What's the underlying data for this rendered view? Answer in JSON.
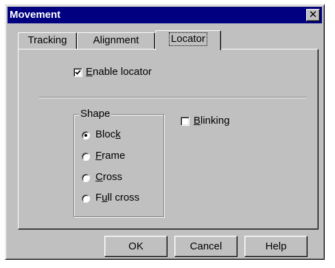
{
  "window": {
    "title": "Movement",
    "close_glyph": "✕"
  },
  "tabs": [
    {
      "label": "Tracking",
      "active": false
    },
    {
      "label": "Alignment",
      "active": false
    },
    {
      "label": "Locator",
      "active": true
    }
  ],
  "enable_locator": {
    "mnemonic": "E",
    "rest": "nable locator",
    "checked": true
  },
  "shape_group": {
    "title": "Shape",
    "options": [
      {
        "pre": "Bloc",
        "mnemonic": "k",
        "post": "",
        "selected": true
      },
      {
        "pre": "",
        "mnemonic": "F",
        "post": "rame",
        "selected": false
      },
      {
        "pre": "",
        "mnemonic": "C",
        "post": "ross",
        "selected": false
      },
      {
        "pre": "F",
        "mnemonic": "u",
        "post": "ll cross",
        "selected": false
      }
    ]
  },
  "blinking": {
    "mnemonic": "B",
    "rest": "linking",
    "checked": false
  },
  "buttons": {
    "ok": "OK",
    "cancel": "Cancel",
    "help": "Help"
  },
  "colors": {
    "face": "#c0c0c0",
    "titlebar": "#000080",
    "title_text": "#ffffff"
  }
}
